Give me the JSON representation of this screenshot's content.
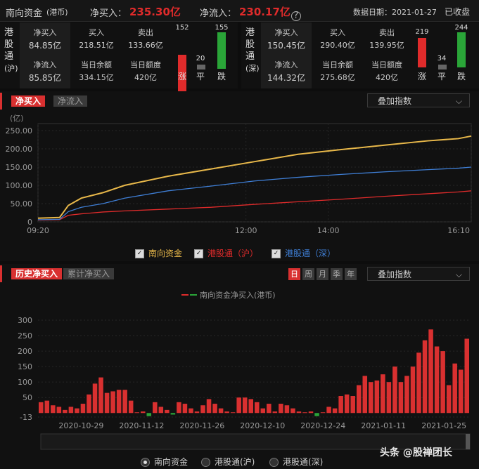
{
  "header": {
    "title": "南向资金",
    "unit": "(港币)",
    "net_buy_label": "净买入：",
    "net_buy_value": "235.30亿",
    "net_inflow_label": "净流入：",
    "net_inflow_value": "230.17亿",
    "help_glyph": "?",
    "date_label": "数据日期：2021-01-27",
    "status": "已收盘"
  },
  "sh": {
    "name": [
      "港",
      "股",
      "通",
      "(沪)"
    ],
    "net_buy_label": "净买入",
    "net_buy": "84.85亿",
    "net_inflow_label": "净流入",
    "net_inflow": "85.85亿",
    "buy_label": "买入",
    "buy": "218.51亿",
    "sell_label": "卖出",
    "sell": "133.66亿",
    "balance_label": "当日余额",
    "balance": "334.15亿",
    "quota_label": "当日额度",
    "quota": "420亿",
    "up": "152",
    "flat": "20",
    "down": "155",
    "up_label": "涨",
    "flat_label": "平",
    "down_label": "跌"
  },
  "sz": {
    "name": [
      "港",
      "股",
      "通",
      "(深)"
    ],
    "net_buy_label": "净买入",
    "net_buy": "150.45亿",
    "net_inflow_label": "净流入",
    "net_inflow": "144.32亿",
    "buy_label": "买入",
    "buy": "290.40亿",
    "sell_label": "卖出",
    "sell": "139.95亿",
    "balance_label": "当日余额",
    "balance": "275.68亿",
    "quota_label": "当日额度",
    "quota": "420亿",
    "up": "219",
    "flat": "34",
    "down": "244",
    "up_label": "涨",
    "flat_label": "平",
    "down_label": "跌"
  },
  "intraday": {
    "tab_active": "净买入",
    "tab_inactive": "净流入",
    "overlay": "叠加指数",
    "legend": [
      "南向资金",
      "港股通（沪）",
      "港股通（深）"
    ]
  },
  "history": {
    "tab_active": "历史净买入",
    "tab_inactive": "累计净买入",
    "periods": [
      "日",
      "周",
      "月",
      "季",
      "年"
    ],
    "overlay": "叠加指数",
    "radios": [
      "南向资金",
      "港股通(沪)",
      "港股通(深)"
    ]
  },
  "watermark": "头条 @股禅团长",
  "colors": {
    "red": "#e02b2b",
    "green": "#2aa538",
    "gold": "#e8b84a",
    "blue": "#3f7fd6"
  },
  "chart_data": [
    {
      "type": "line",
      "title": "",
      "ylabel": "(亿)",
      "ylim": [
        0,
        250
      ],
      "yticks": [
        "250.00",
        "200.00",
        "150.00",
        "100.00",
        "50.00",
        "0"
      ],
      "xticks": [
        "09:20",
        "12:00",
        "14:00",
        "16:10"
      ],
      "x": [
        0,
        0.05,
        0.07,
        0.1,
        0.15,
        0.2,
        0.3,
        0.4,
        0.5,
        0.6,
        0.7,
        0.8,
        0.9,
        0.97,
        1.0
      ],
      "series": [
        {
          "name": "南向资金",
          "color": "#e8b84a",
          "values": [
            10,
            12,
            45,
            65,
            80,
            100,
            125,
            145,
            165,
            185,
            198,
            210,
            222,
            228,
            235
          ]
        },
        {
          "name": "港股通（沪）",
          "color": "#e02b2b",
          "values": [
            5,
            6,
            18,
            22,
            27,
            30,
            35,
            40,
            48,
            55,
            62,
            70,
            77,
            82,
            85
          ]
        },
        {
          "name": "港股通（深）",
          "color": "#3f7fd6",
          "values": [
            6,
            7,
            28,
            40,
            50,
            65,
            85,
            98,
            112,
            122,
            130,
            137,
            143,
            147,
            150
          ]
        }
      ]
    },
    {
      "type": "bar",
      "title": "南向资金净买入(港币)",
      "ylim": [
        -13,
        300
      ],
      "yticks": [
        "300",
        "250",
        "200",
        "150",
        "100",
        "50",
        "-13"
      ],
      "xticks": [
        "2020-10-29",
        "2020-11-12",
        "2020-11-26",
        "2020-12-10",
        "2020-12-24",
        "2021-01-11",
        "2021-01-25"
      ],
      "values": [
        35,
        40,
        25,
        20,
        10,
        20,
        15,
        30,
        60,
        95,
        115,
        65,
        70,
        75,
        75,
        40,
        0,
        5,
        -10,
        35,
        20,
        10,
        -5,
        35,
        30,
        15,
        5,
        25,
        45,
        30,
        15,
        5,
        0,
        50,
        50,
        45,
        35,
        15,
        30,
        5,
        30,
        25,
        15,
        5,
        0,
        5,
        -10,
        0,
        20,
        15,
        55,
        60,
        55,
        90,
        120,
        100,
        105,
        125,
        100,
        150,
        100,
        120,
        150,
        195,
        235,
        270,
        215,
        200,
        90,
        160,
        140,
        240
      ]
    }
  ]
}
